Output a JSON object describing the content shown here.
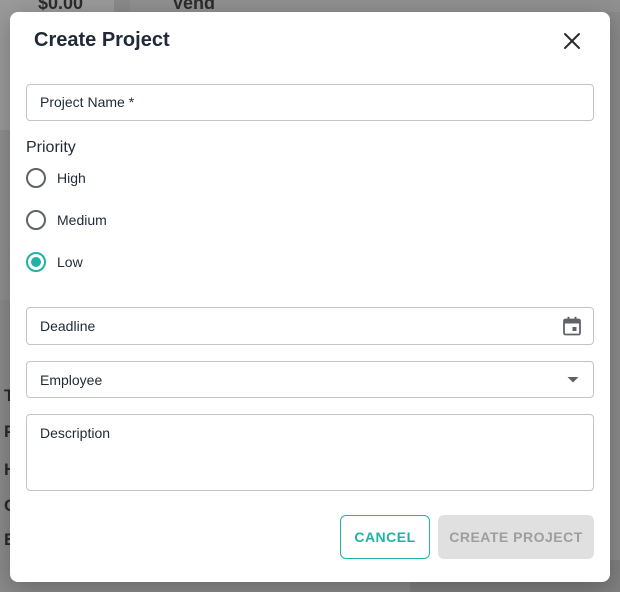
{
  "background": {
    "price_fragment": "$0.00",
    "header_fragment": "Vend",
    "side_letters": [
      "T",
      "P",
      "H",
      "C",
      "E"
    ]
  },
  "dialog": {
    "title": "Create Project",
    "fields": {
      "project_name_label": "Project Name *",
      "priority_label": "Priority",
      "deadline_label": "Deadline",
      "employee_label": "Employee",
      "description_label": "Description"
    },
    "priority_options": [
      {
        "label": "High",
        "checked": false
      },
      {
        "label": "Medium",
        "checked": false
      },
      {
        "label": "Low",
        "checked": true
      }
    ],
    "buttons": {
      "cancel": "CANCEL",
      "create": "CREATE PROJECT"
    }
  },
  "colors": {
    "accent": "#20b2a5",
    "disabled_bg": "#e0e0e0",
    "disabled_text": "#9e9e9e",
    "border": "#c4c4c4",
    "text": "#1f2937"
  },
  "icons": {
    "close": "close-icon",
    "calendar": "calendar-icon",
    "dropdown": "chevron-down-icon"
  }
}
